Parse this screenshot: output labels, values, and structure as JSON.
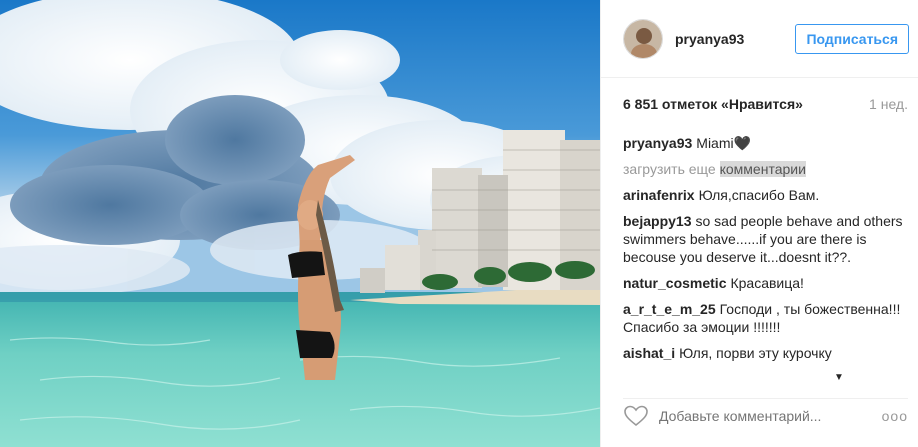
{
  "post": {
    "username": "pryanya93",
    "follow_label": "Подписаться",
    "likes": "6 851 отметок «Нравится»",
    "time": "1 нед.",
    "caption": {
      "user": "pryanya93",
      "text": "Miami🖤"
    },
    "load_more_prefix": "загрузить еще ",
    "load_more_highlight": "комментарии",
    "comments": [
      {
        "user": "arinafenrix",
        "text": "Юля,спасибо Вам."
      },
      {
        "user": "bejappy13",
        "text": "so sad people behave and others swimmers behave......if you are there is becouse you deserve it...doesnt it??."
      },
      {
        "user": "natur_cosmetic",
        "text": "Красавица!"
      },
      {
        "user": "a_r_t_e_m_25",
        "text": "Господи , ты божественна!!! Спасибо за эмоции !!!!!!!"
      },
      {
        "user": "aishat_i",
        "text": "Юля, порви эту курочку"
      }
    ],
    "add_comment_placeholder": "Добавьте комментарий...",
    "more_label": "ooo"
  },
  "icons": {
    "heart": "heart-outline-icon",
    "scroll": "scroll-down-arrow-icon",
    "more": "more-options-icon"
  }
}
